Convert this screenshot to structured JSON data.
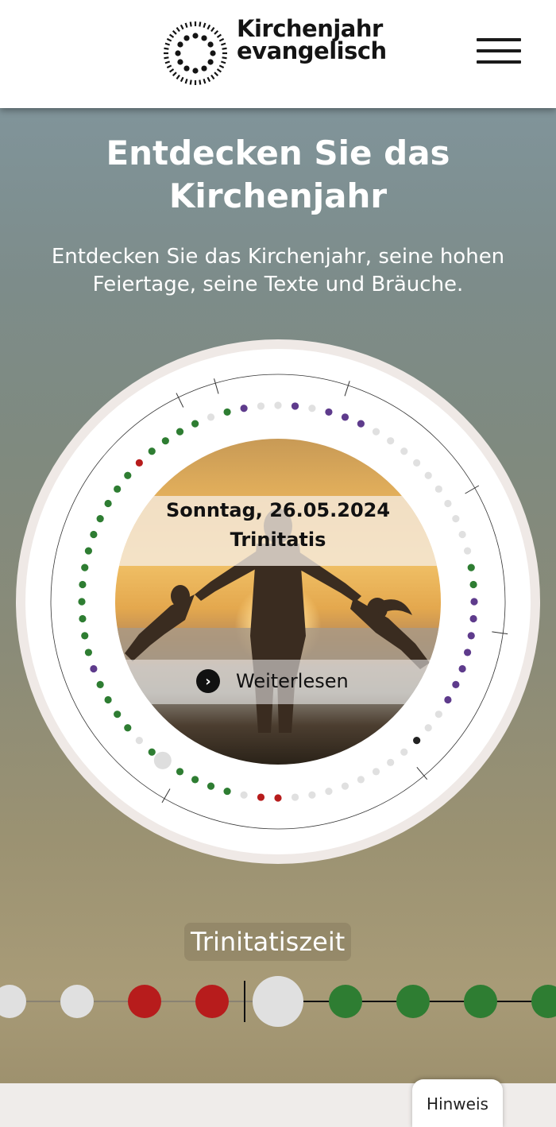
{
  "brand": {
    "line1": "Kirchenjahr",
    "line2": "evangelisch",
    "logo_icon": "dotted-sun-circle-icon"
  },
  "header": {
    "menu_icon": "hamburger-menu-icon"
  },
  "hero": {
    "title": "Entdecken Sie das Kirchenjahr",
    "subtitle": "Entdecken Sie das Kirchenjahr, seine hohen Feiertage, seine Texte und Bräuche."
  },
  "wheel": {
    "date": "Sonntag, 26.05.2024",
    "feast": "Trinitatis",
    "read_more_label": "Weiterlesen",
    "read_more_icon": "chevron-right-icon",
    "colors": {
      "green": "#2e7d32",
      "purple": "#5e3b8c",
      "red": "#b71c1c",
      "white": "#e0e0e0",
      "black": "#222222"
    }
  },
  "season": {
    "label": "Trinitatiszeit"
  },
  "timeline": {
    "current_index": 4,
    "dots": [
      "white",
      "white",
      "red",
      "red",
      "white",
      "green",
      "green",
      "green",
      "green"
    ]
  },
  "footer": {
    "hint_label": "Hinweis"
  }
}
